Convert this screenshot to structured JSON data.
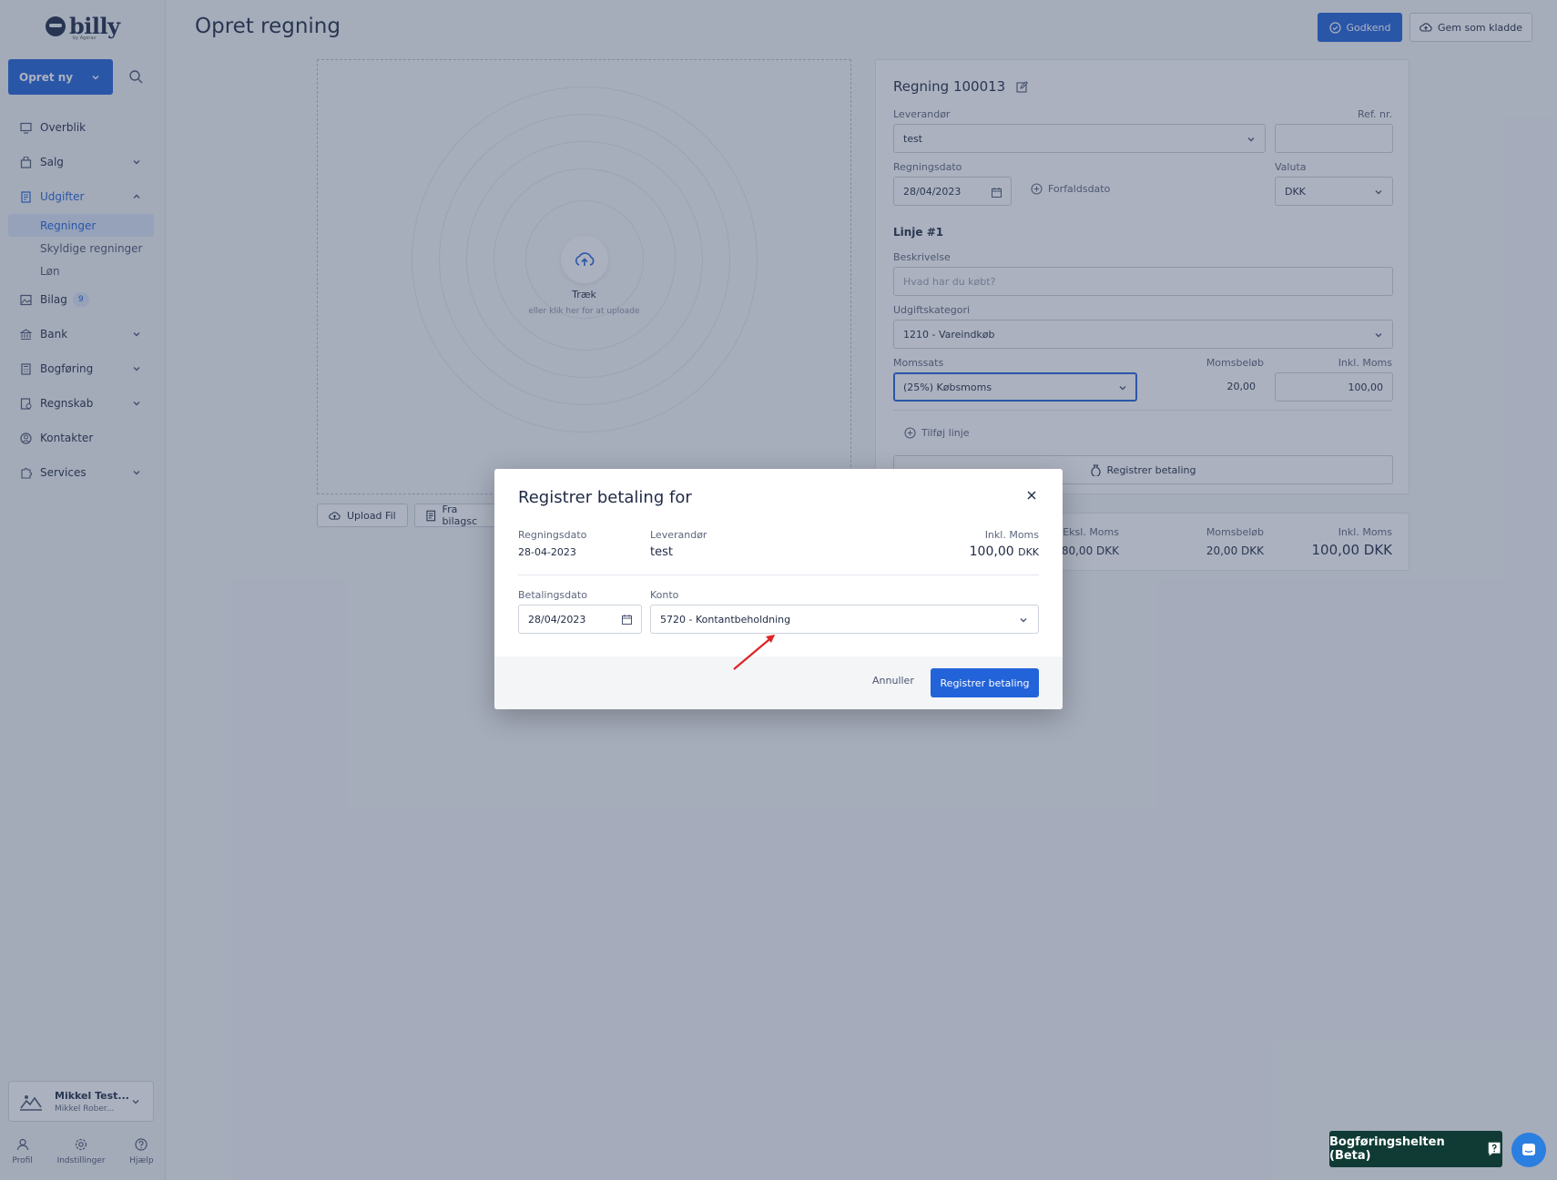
{
  "brand": {
    "name": "billy",
    "sub": "by Ageras"
  },
  "sidebar": {
    "create_label": "Opret ny",
    "items": [
      {
        "label": "Overblik"
      },
      {
        "label": "Salg"
      },
      {
        "label": "Udgifter"
      },
      {
        "label": "Bilag",
        "badge": "9"
      },
      {
        "label": "Bank"
      },
      {
        "label": "Bogføring"
      },
      {
        "label": "Regnskab"
      },
      {
        "label": "Kontakter"
      },
      {
        "label": "Services"
      }
    ],
    "sub_items": [
      "Regninger",
      "Skyldige regninger",
      "Løn"
    ],
    "user": {
      "name": "Mikkel Test...",
      "org": "Mikkel Rober..."
    },
    "bottom": [
      "Profil",
      "Indstillinger",
      "Hjælp"
    ]
  },
  "header": {
    "title": "Opret regning",
    "approve_label": "Godkend",
    "draft_label": "Gem som kladde"
  },
  "upload": {
    "drag_label": "Træk",
    "drag_sub": "eller klik her for at uploade",
    "upload_file": "Upload Fil",
    "from_inbox": "Fra bilagsc"
  },
  "form": {
    "bill_title": "Regning 100013",
    "supplier_label": "Leverandør",
    "supplier_value": "test",
    "ref_label": "Ref. nr.",
    "ref_value": "",
    "date_label": "Regningsdato",
    "date_value": "28/04/2023",
    "due_label": "Forfaldsdato",
    "currency_label": "Valuta",
    "currency_value": "DKK",
    "line_heading": "Linje #1",
    "desc_label": "Beskrivelse",
    "desc_placeholder": "Hvad har du købt?",
    "category_label": "Udgiftskategori",
    "category_value": "1210 -  Vareindkøb",
    "vat_label": "Momssats",
    "vat_value": "(25%) Købsmoms",
    "vat_amount_label": "Momsbeløb",
    "vat_amount_value": "20,00",
    "incl_label": "Inkl. Moms",
    "incl_value": "100,00",
    "add_line": "Tilføj linje",
    "register_payment": "Registrer betaling"
  },
  "totals": {
    "excl_label": "Eksl. Moms",
    "excl_value": "80,00 DKK",
    "vat_label": "Momsbeløb",
    "vat_value": "20,00 DKK",
    "incl_label": "Inkl. Moms",
    "incl_value": "100,00 DKK"
  },
  "modal": {
    "title": "Registrer betaling for",
    "bill_date_label": "Regningsdato",
    "bill_date_value": "28-04-2023",
    "supplier_label": "Leverandør",
    "supplier_value": "test",
    "incl_label": "Inkl. Moms",
    "incl_amount": "100,00",
    "incl_currency": "DKK",
    "pay_date_label": "Betalingsdato",
    "pay_date_value": "28/04/2023",
    "account_label": "Konto",
    "account_value": "5720 -  Kontantbeholdning",
    "cancel_label": "Annuller",
    "confirm_label": "Registrer betaling"
  },
  "helpers": {
    "bookkeeping_helper": "Bogføringshelten (Beta)"
  },
  "colors": {
    "accent": "#2263d9",
    "helper_bg": "#0f3b34",
    "annotation_arrow": "#e02424"
  }
}
